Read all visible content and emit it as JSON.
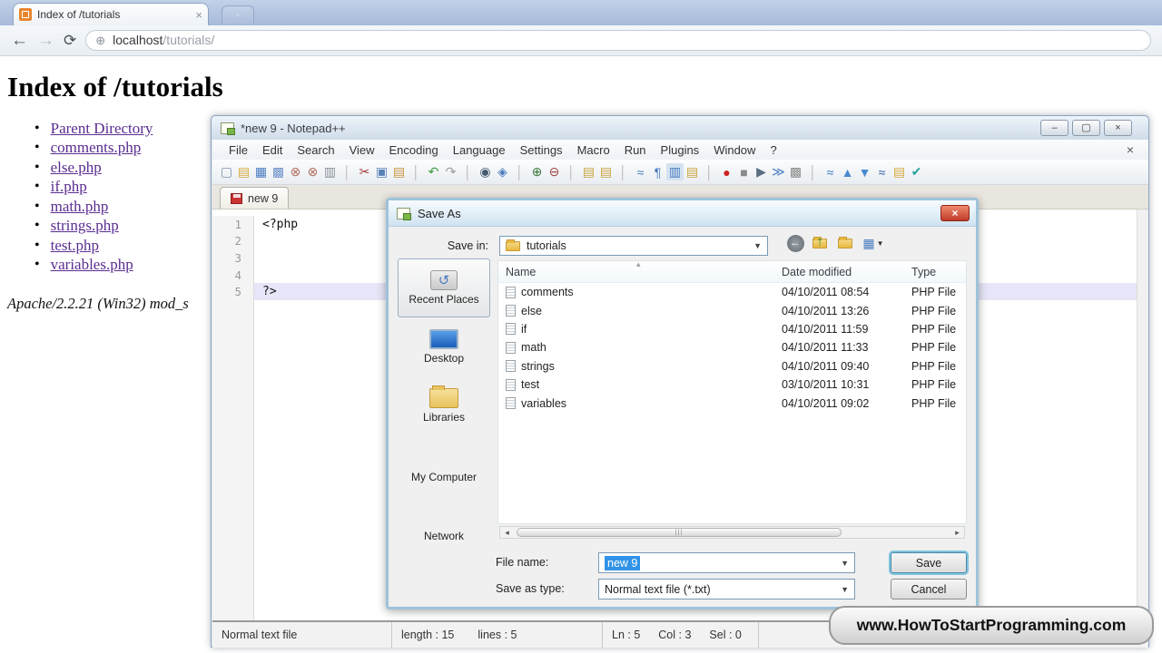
{
  "browser": {
    "tab_title": "Index of /tutorials",
    "tab_close": "×",
    "newtab_glyph": "◦",
    "back_glyph": "←",
    "forward_glyph": "→",
    "reload_glyph": "⟳",
    "globe_glyph": "⊕",
    "url_host": "localhost",
    "url_path": "/tutorials/",
    "page": {
      "heading": "Index of /tutorials",
      "bullet": "•",
      "links": [
        {
          "label": "Parent Directory"
        },
        {
          "label": "comments.php"
        },
        {
          "label": "else.php"
        },
        {
          "label": "if.php"
        },
        {
          "label": "math.php"
        },
        {
          "label": "strings.php"
        },
        {
          "label": "test.php"
        },
        {
          "label": "variables.php"
        }
      ],
      "footer": "Apache/2.2.21 (Win32) mod_s"
    }
  },
  "notepad": {
    "title": "*new 9 - Notepad++",
    "window_buttons": {
      "minimize": "–",
      "maximize": "▢",
      "close": "×"
    },
    "menus": [
      {
        "label": "File"
      },
      {
        "label": "Edit"
      },
      {
        "label": "Search"
      },
      {
        "label": "View"
      },
      {
        "label": "Encoding"
      },
      {
        "label": "Language"
      },
      {
        "label": "Settings"
      },
      {
        "label": "Macro"
      },
      {
        "label": "Run"
      },
      {
        "label": "Plugins"
      },
      {
        "label": "Window"
      },
      {
        "label": "?"
      }
    ],
    "menu_close_x": "×",
    "toolbar_icons": [
      {
        "name": "new-file-icon",
        "glyph": "▢",
        "color": "#7a8fa8"
      },
      {
        "name": "open-icon",
        "glyph": "▤",
        "color": "#d8a93e"
      },
      {
        "name": "save-icon",
        "glyph": "▦",
        "color": "#4a7dc0"
      },
      {
        "name": "save-all-icon",
        "glyph": "▩",
        "color": "#6f93c9"
      },
      {
        "name": "close-icon",
        "glyph": "⊗",
        "color": "#b06a5a"
      },
      {
        "name": "close-all-icon",
        "glyph": "⊗",
        "color": "#b06a5a"
      },
      {
        "name": "print-icon",
        "glyph": "▥",
        "color": "#8a9099"
      },
      {
        "name": "divider",
        "glyph": "│",
        "color": "#b8b8b8"
      },
      {
        "name": "cut-icon",
        "glyph": "✂",
        "color": "#a33c3c"
      },
      {
        "name": "copy-icon",
        "glyph": "▣",
        "color": "#5a82b8"
      },
      {
        "name": "paste-icon",
        "glyph": "▤",
        "color": "#c9923e"
      },
      {
        "name": "divider",
        "glyph": "│",
        "color": "#b8b8b8"
      },
      {
        "name": "undo-icon",
        "glyph": "↶",
        "color": "#3d9a3d"
      },
      {
        "name": "redo-icon",
        "glyph": "↷",
        "color": "#9a9a9a"
      },
      {
        "name": "divider",
        "glyph": "│",
        "color": "#b8b8b8"
      },
      {
        "name": "find-icon",
        "glyph": "◉",
        "color": "#44586e"
      },
      {
        "name": "replace-icon",
        "glyph": "◈",
        "color": "#4a7dc0"
      },
      {
        "name": "divider",
        "glyph": "│",
        "color": "#b8b8b8"
      },
      {
        "name": "zoom-in-icon",
        "glyph": "⊕",
        "color": "#3d7a3d"
      },
      {
        "name": "zoom-out-icon",
        "glyph": "⊖",
        "color": "#a04444"
      },
      {
        "name": "divider",
        "glyph": "│",
        "color": "#b8b8b8"
      },
      {
        "name": "sync-scroll-v-icon",
        "glyph": "▤",
        "color": "#c9a33e"
      },
      {
        "name": "sync-scroll-h-icon",
        "glyph": "▤",
        "color": "#c9a33e"
      },
      {
        "name": "divider",
        "glyph": "│",
        "color": "#b8b8b8"
      },
      {
        "name": "word-wrap-icon",
        "glyph": "≈",
        "color": "#4a7dc0"
      },
      {
        "name": "show-all-chars-icon",
        "glyph": "¶",
        "color": "#4a7dc0"
      },
      {
        "name": "indent-guide-icon",
        "glyph": "▥",
        "color": "#4a7dc0",
        "bg": "#d4e2f0"
      },
      {
        "name": "doc-map-icon",
        "glyph": "▤",
        "color": "#c9a33e"
      },
      {
        "name": "divider",
        "glyph": "│",
        "color": "#b8b8b8"
      },
      {
        "name": "record-macro-icon",
        "glyph": "●",
        "color": "#cc2222"
      },
      {
        "name": "stop-macro-icon",
        "glyph": "■",
        "color": "#8a8a8a"
      },
      {
        "name": "play-macro-icon",
        "glyph": "▶",
        "color": "#5a6e84"
      },
      {
        "name": "run-macro-multi-icon",
        "glyph": "≫",
        "color": "#4a7dc0"
      },
      {
        "name": "save-macro-icon",
        "glyph": "▩",
        "color": "#8a8a8a"
      },
      {
        "name": "divider",
        "glyph": "│",
        "color": "#b8b8b8"
      },
      {
        "name": "start-record-icon",
        "glyph": "≈",
        "color": "#3a7ac0"
      },
      {
        "name": "prev-icon",
        "glyph": "▲",
        "color": "#4a8ad0"
      },
      {
        "name": "next-icon",
        "glyph": "▼",
        "color": "#4a8ad0"
      },
      {
        "name": "end-record-icon",
        "glyph": "≈",
        "color": "#2a5aa0"
      },
      {
        "name": "doc-switcher-icon",
        "glyph": "▤",
        "color": "#d8a93e"
      },
      {
        "name": "spell-check-icon",
        "glyph": "✔",
        "color": "#2aa0a0"
      }
    ],
    "doc_tab": "new 9",
    "editor_lines": [
      {
        "num": "1",
        "code": "<?php",
        "bg": ""
      },
      {
        "num": "2",
        "code": "",
        "bg": ""
      },
      {
        "num": "3",
        "code": "",
        "bg": ""
      },
      {
        "num": "4",
        "code": "",
        "bg": ""
      },
      {
        "num": "5",
        "code": "?>",
        "bg": "#e6e6f8"
      }
    ],
    "statusbar": {
      "doc_type": "Normal text file",
      "length": "length : 15",
      "lines": "lines : 5",
      "ln": "Ln : 5",
      "col": "Col : 3",
      "sel": "Sel : 0"
    }
  },
  "dialog": {
    "title": "Save As",
    "close_glyph": "×",
    "save_in_label": "Save in:",
    "save_in_value": "tutorials",
    "combo_caret": "▼",
    "nav": {
      "back_glyph": "←",
      "up_glyph": "↑",
      "views_glyph": "▦",
      "views_caret": "▼"
    },
    "sidebar": [
      {
        "label": "Recent Places",
        "icon": "ic-recent",
        "glyph": "↺",
        "selected": true
      },
      {
        "label": "Desktop",
        "icon": "ic-desktop",
        "glyph": ""
      },
      {
        "label": "Libraries",
        "icon": "ic-libraries",
        "glyph": ""
      },
      {
        "label": "My Computer",
        "icon": "ic-computer",
        "glyph": ""
      },
      {
        "label": "Network",
        "icon": "ic-network",
        "glyph": ""
      }
    ],
    "columns": {
      "name": "Name",
      "date": "Date modified",
      "type": "Type"
    },
    "sort_caret": "▴",
    "files": [
      {
        "name": "comments",
        "date": "04/10/2011 08:54",
        "type": "PHP File"
      },
      {
        "name": "else",
        "date": "04/10/2011 13:26",
        "type": "PHP File"
      },
      {
        "name": "if",
        "date": "04/10/2011 11:59",
        "type": "PHP File"
      },
      {
        "name": "math",
        "date": "04/10/2011 11:33",
        "type": "PHP File"
      },
      {
        "name": "strings",
        "date": "04/10/2011 09:40",
        "type": "PHP File"
      },
      {
        "name": "test",
        "date": "03/10/2011 10:31",
        "type": "PHP File"
      },
      {
        "name": "variables",
        "date": "04/10/2011 09:02",
        "type": "PHP File"
      }
    ],
    "hscroll": {
      "left_arrow": "◂",
      "right_arrow": "▸",
      "grip": "|||"
    },
    "file_name_label": "File name:",
    "file_name_value": "new 9",
    "save_as_type_label": "Save as type:",
    "save_as_type_value": "Normal text file (*.txt)",
    "save_button": "Save",
    "cancel_button": "Cancel"
  },
  "watermark": "www.HowToStartProgramming.com",
  "colors": {
    "accent_selection": "#3093e8",
    "link_visited": "#5a2d91",
    "favicon_orange": "#e8862e",
    "dialog_border": "#9dc3da",
    "close_button_red": "#c13b28",
    "current_line": "#e6e6f8"
  }
}
